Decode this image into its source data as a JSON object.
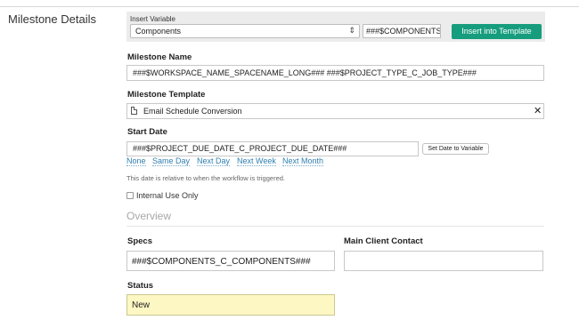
{
  "section_title": "Milestone Details",
  "insert_variable": {
    "label": "Insert Variable",
    "selected": "Components",
    "variable_code": "###$COMPONENTS",
    "button_label": "Insert into Template"
  },
  "milestone_name": {
    "label": "Milestone Name",
    "value": "###$WORKSPACE_NAME_SPACENAME_LONG### ###$PROJECT_TYPE_C_JOB_TYPE###"
  },
  "milestone_template": {
    "label": "Milestone Template",
    "value": "Email Schedule Conversion",
    "clear_glyph": "✕"
  },
  "start_date": {
    "label": "Start Date",
    "value": "###$PROJECT_DUE_DATE_C_PROJECT_DUE_DATE###",
    "set_button_label": "Set Date to Variable",
    "quick_links": [
      "None",
      "Same Day",
      "Next Day",
      "Next Week",
      "Next Month"
    ],
    "help_text": "This date is relative to when the workflow is triggered."
  },
  "internal_use": {
    "label": "Internal Use Only",
    "checked": false
  },
  "overview": {
    "title": "Overview",
    "specs_label": "Specs",
    "specs_value": "###$COMPONENTS_C_COMPONENTS###",
    "main_client_contact_label": "Main Client Contact",
    "main_client_contact_value": "",
    "status_label": "Status",
    "status_value": "New"
  },
  "colors": {
    "primary_button": "#169d7e",
    "link": "#2f7fb0",
    "status_highlight": "#fdf7c3"
  }
}
